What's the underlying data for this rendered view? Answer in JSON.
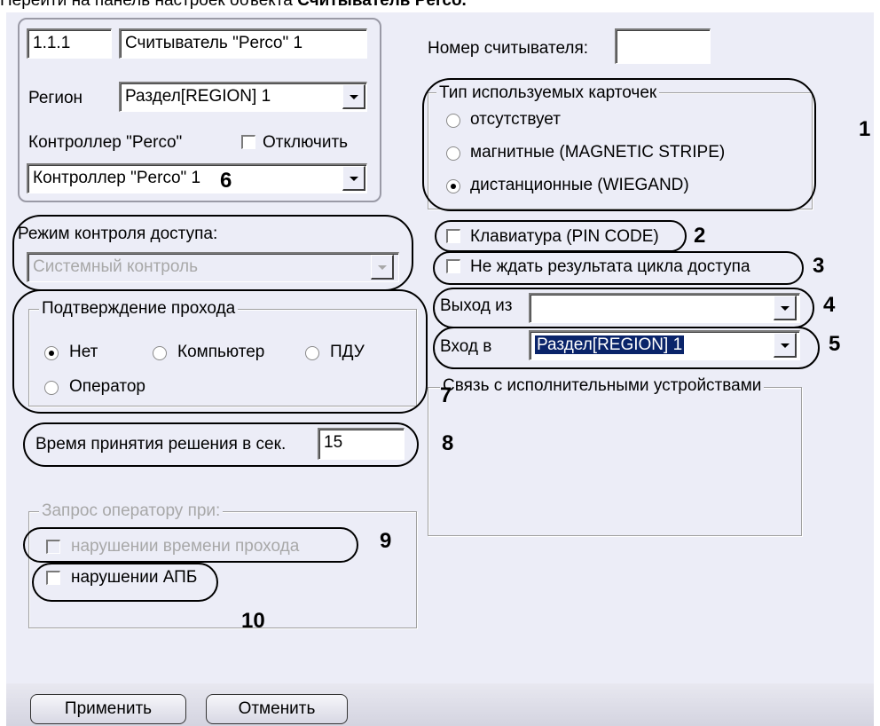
{
  "header_text": {
    "prefix": "Перейти на панель настроек объекта",
    "object_name": "Считыватель Perco."
  },
  "object": {
    "id": "1.1.1",
    "name": "Считыватель \"Perco\" 1"
  },
  "region": {
    "label": "Регион",
    "value": "Раздел[REGION] 1"
  },
  "controller": {
    "label": "Контроллер \"Perco\"",
    "disable_label": "Отключить",
    "disable_checked": false,
    "value": "Контроллер \"Perco\" 1"
  },
  "reader_number": {
    "label": "Номер считывателя:",
    "value": ""
  },
  "card_types": {
    "title": "Тип используемых карточек",
    "options": [
      {
        "label": "отсутствует",
        "selected": false
      },
      {
        "label": "магнитные (MAGNETIC STRIPE)",
        "selected": false
      },
      {
        "label": "дистанционные (WIEGAND)",
        "selected": true
      }
    ]
  },
  "keyboard": {
    "label": "Клавиатура (PIN CODE)",
    "checked": false
  },
  "no_wait": {
    "label": "Не ждать результата цикла доступа",
    "checked": false
  },
  "access_mode": {
    "label": "Режим контроля доступа:",
    "value": "Системный контроль"
  },
  "exit_from": {
    "label": "Выход из",
    "value": ""
  },
  "enter_to": {
    "label": "Вход в",
    "value": "Раздел[REGION] 1"
  },
  "pass_confirm": {
    "title": "Подтверждение прохода",
    "options": [
      {
        "label": "Нет",
        "selected": true
      },
      {
        "label": "Компьютер",
        "selected": false
      },
      {
        "label": "ПДУ",
        "selected": false
      },
      {
        "label": "Оператор",
        "selected": false
      }
    ]
  },
  "executive_devices": {
    "title": "Связь с исполнительными устройствами"
  },
  "decision_time": {
    "label": "Время принятия решения в сек.",
    "value": "15"
  },
  "operator_request": {
    "title": "Запрос оператору при:",
    "items": [
      {
        "label": "нарушении времени прохода",
        "checked": false,
        "enabled": false
      },
      {
        "label": "нарушении АПБ",
        "checked": false,
        "enabled": true
      }
    ]
  },
  "buttons": {
    "apply": "Применить",
    "cancel": "Отменить"
  },
  "annotations": [
    "1",
    "2",
    "3",
    "4",
    "5",
    "6",
    "7",
    "8",
    "9",
    "10"
  ]
}
